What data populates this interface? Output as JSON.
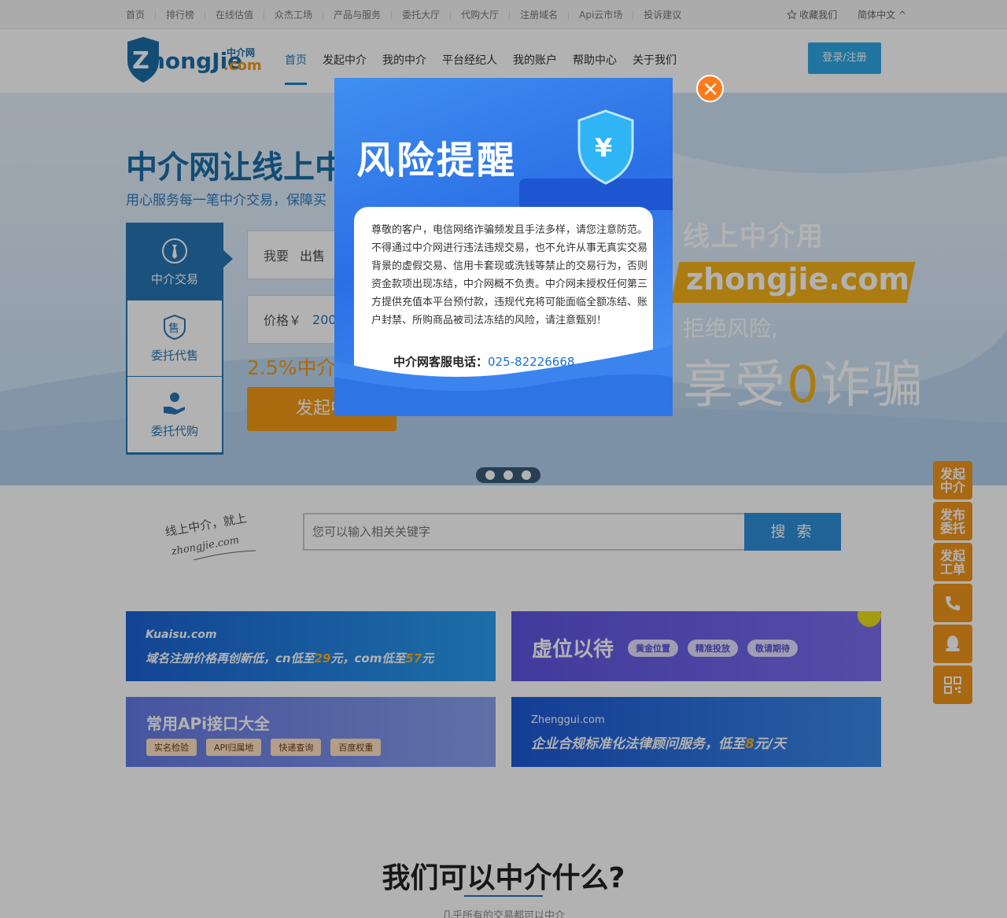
{
  "topbar": {
    "links": [
      "首页",
      "排行榜",
      "在线估值",
      "众杰工场",
      "产品与服务",
      "委托大厅",
      "代购大厅",
      "注册域名",
      "Api云市场",
      "投诉建议"
    ],
    "favorite": "收藏我们",
    "language": "简体中文"
  },
  "header": {
    "nav": [
      "首页",
      "发起中介",
      "我的中介",
      "平台经纪人",
      "我的账户",
      "帮助中心",
      "关于我们"
    ],
    "login": "登录/注册"
  },
  "banner": {
    "headline": "中介网让线上中",
    "subline": "用心服务每一笔中介交易，保障买",
    "tabs": [
      "中介交易",
      "委托代售",
      "委托代购"
    ],
    "field1_label": "我要",
    "field1_value": "出售",
    "field2_label": "价格￥",
    "field2_value": "200",
    "fee": "2.5%中介",
    "start": "发起中",
    "promo_line1": "线上中介用",
    "promo_line2": "zhongjie.com",
    "promo_line3": "拒绝风险,",
    "promo_line4_a": "享受",
    "promo_line4_b": "0",
    "promo_line4_c": "诈骗"
  },
  "search": {
    "placeholder": "您可以输入相关关键字",
    "button": "搜 索",
    "slogan_line1": "线上中介，就上",
    "slogan_line2": "zhongjie.com"
  },
  "ads": {
    "ad1_brand": "Kuaisu.com",
    "ad1_text_a": "域名注册价格再创新低，",
    "ad1_text_b": "cn",
    "ad1_text_c": "低至",
    "ad1_text_d": "29",
    "ad1_text_e": "元，",
    "ad1_text_f": "com",
    "ad1_text_g": "低至",
    "ad1_text_h": "57",
    "ad1_text_i": "元",
    "ad2_title": "虚位以待",
    "ad2_pills": [
      "黄金位置",
      "精准投放",
      "敬请期待"
    ],
    "ad3_title": "常用APi接口大全",
    "ad3_pills": [
      "实名检验",
      "API归属地",
      "快递查询",
      "百度权重"
    ],
    "ad4_brand": "Zhenggui.com",
    "ad4_text_a": "企业合规标准化法律顾问服务，低至",
    "ad4_text_b": "8",
    "ad4_text_c": "元/天"
  },
  "section": {
    "title": "我们可以中介什么?",
    "subtitle": "几乎所有的交易都可以中介"
  },
  "floats": [
    "发起中介",
    "发布委托",
    "发起工单"
  ],
  "modal": {
    "title": "风险提醒",
    "body": "尊敬的客户，电信网络诈骗频发且手法多样，请您注意防范。不得通过中介网进行违法违规交易，也不允许从事无真实交易背景的虚假交易、信用卡套现或洗钱等禁止的交易行为，否则资金款项出现冻结，中介网概不负责。中介网未授权任何第三方提供充值本平台预付款，违规代充将可能面临全额冻结、账户封禁、所购商品被司法冻结的风险，请注意甄别！",
    "hotline_label": "中介网客服电话：",
    "hotline_number": "025-82226668"
  },
  "logo": {
    "text": "ZhongJie",
    "cn": "中介网",
    "dom": ".com"
  },
  "colors": {
    "primary": "#2874b4",
    "accent": "#f39a14",
    "modal": "#2b6fe6",
    "close": "#ff7a1a"
  }
}
